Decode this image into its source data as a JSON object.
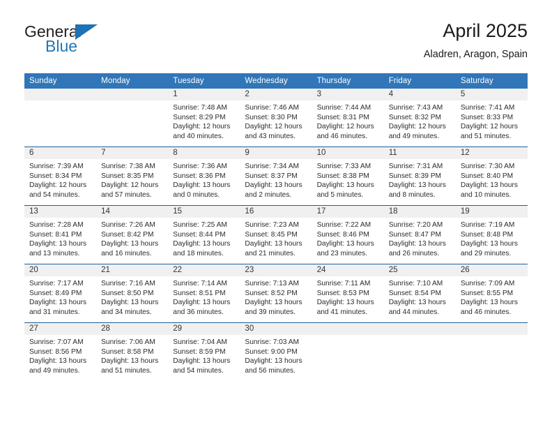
{
  "logo": {
    "primary_text": "General",
    "secondary_text": "Blue",
    "accent_color": "#1e72b5",
    "triangle_icon": "triangle-icon"
  },
  "header": {
    "title": "April 2025",
    "location": "Aladren, Aragon, Spain"
  },
  "theme": {
    "header_bg": "#3076b8",
    "row_divider": "#1b5f9e",
    "daynum_bg": "#f0f0f0"
  },
  "calendar": {
    "weekday_headers": [
      "Sunday",
      "Monday",
      "Tuesday",
      "Wednesday",
      "Thursday",
      "Friday",
      "Saturday"
    ],
    "labels": {
      "sunrise": "Sunrise:",
      "sunset": "Sunset:",
      "daylight": "Daylight:"
    },
    "weeks": [
      [
        {
          "day": "",
          "empty": true
        },
        {
          "day": "",
          "empty": true
        },
        {
          "day": "1",
          "sunrise": "Sunrise: 7:48 AM",
          "sunset": "Sunset: 8:29 PM",
          "daylight": "Daylight: 12 hours and 40 minutes."
        },
        {
          "day": "2",
          "sunrise": "Sunrise: 7:46 AM",
          "sunset": "Sunset: 8:30 PM",
          "daylight": "Daylight: 12 hours and 43 minutes."
        },
        {
          "day": "3",
          "sunrise": "Sunrise: 7:44 AM",
          "sunset": "Sunset: 8:31 PM",
          "daylight": "Daylight: 12 hours and 46 minutes."
        },
        {
          "day": "4",
          "sunrise": "Sunrise: 7:43 AM",
          "sunset": "Sunset: 8:32 PM",
          "daylight": "Daylight: 12 hours and 49 minutes."
        },
        {
          "day": "5",
          "sunrise": "Sunrise: 7:41 AM",
          "sunset": "Sunset: 8:33 PM",
          "daylight": "Daylight: 12 hours and 51 minutes."
        }
      ],
      [
        {
          "day": "6",
          "sunrise": "Sunrise: 7:39 AM",
          "sunset": "Sunset: 8:34 PM",
          "daylight": "Daylight: 12 hours and 54 minutes."
        },
        {
          "day": "7",
          "sunrise": "Sunrise: 7:38 AM",
          "sunset": "Sunset: 8:35 PM",
          "daylight": "Daylight: 12 hours and 57 minutes."
        },
        {
          "day": "8",
          "sunrise": "Sunrise: 7:36 AM",
          "sunset": "Sunset: 8:36 PM",
          "daylight": "Daylight: 13 hours and 0 minutes."
        },
        {
          "day": "9",
          "sunrise": "Sunrise: 7:34 AM",
          "sunset": "Sunset: 8:37 PM",
          "daylight": "Daylight: 13 hours and 2 minutes."
        },
        {
          "day": "10",
          "sunrise": "Sunrise: 7:33 AM",
          "sunset": "Sunset: 8:38 PM",
          "daylight": "Daylight: 13 hours and 5 minutes."
        },
        {
          "day": "11",
          "sunrise": "Sunrise: 7:31 AM",
          "sunset": "Sunset: 8:39 PM",
          "daylight": "Daylight: 13 hours and 8 minutes."
        },
        {
          "day": "12",
          "sunrise": "Sunrise: 7:30 AM",
          "sunset": "Sunset: 8:40 PM",
          "daylight": "Daylight: 13 hours and 10 minutes."
        }
      ],
      [
        {
          "day": "13",
          "sunrise": "Sunrise: 7:28 AM",
          "sunset": "Sunset: 8:41 PM",
          "daylight": "Daylight: 13 hours and 13 minutes."
        },
        {
          "day": "14",
          "sunrise": "Sunrise: 7:26 AM",
          "sunset": "Sunset: 8:42 PM",
          "daylight": "Daylight: 13 hours and 16 minutes."
        },
        {
          "day": "15",
          "sunrise": "Sunrise: 7:25 AM",
          "sunset": "Sunset: 8:44 PM",
          "daylight": "Daylight: 13 hours and 18 minutes."
        },
        {
          "day": "16",
          "sunrise": "Sunrise: 7:23 AM",
          "sunset": "Sunset: 8:45 PM",
          "daylight": "Daylight: 13 hours and 21 minutes."
        },
        {
          "day": "17",
          "sunrise": "Sunrise: 7:22 AM",
          "sunset": "Sunset: 8:46 PM",
          "daylight": "Daylight: 13 hours and 23 minutes."
        },
        {
          "day": "18",
          "sunrise": "Sunrise: 7:20 AM",
          "sunset": "Sunset: 8:47 PM",
          "daylight": "Daylight: 13 hours and 26 minutes."
        },
        {
          "day": "19",
          "sunrise": "Sunrise: 7:19 AM",
          "sunset": "Sunset: 8:48 PM",
          "daylight": "Daylight: 13 hours and 29 minutes."
        }
      ],
      [
        {
          "day": "20",
          "sunrise": "Sunrise: 7:17 AM",
          "sunset": "Sunset: 8:49 PM",
          "daylight": "Daylight: 13 hours and 31 minutes."
        },
        {
          "day": "21",
          "sunrise": "Sunrise: 7:16 AM",
          "sunset": "Sunset: 8:50 PM",
          "daylight": "Daylight: 13 hours and 34 minutes."
        },
        {
          "day": "22",
          "sunrise": "Sunrise: 7:14 AM",
          "sunset": "Sunset: 8:51 PM",
          "daylight": "Daylight: 13 hours and 36 minutes."
        },
        {
          "day": "23",
          "sunrise": "Sunrise: 7:13 AM",
          "sunset": "Sunset: 8:52 PM",
          "daylight": "Daylight: 13 hours and 39 minutes."
        },
        {
          "day": "24",
          "sunrise": "Sunrise: 7:11 AM",
          "sunset": "Sunset: 8:53 PM",
          "daylight": "Daylight: 13 hours and 41 minutes."
        },
        {
          "day": "25",
          "sunrise": "Sunrise: 7:10 AM",
          "sunset": "Sunset: 8:54 PM",
          "daylight": "Daylight: 13 hours and 44 minutes."
        },
        {
          "day": "26",
          "sunrise": "Sunrise: 7:09 AM",
          "sunset": "Sunset: 8:55 PM",
          "daylight": "Daylight: 13 hours and 46 minutes."
        }
      ],
      [
        {
          "day": "27",
          "sunrise": "Sunrise: 7:07 AM",
          "sunset": "Sunset: 8:56 PM",
          "daylight": "Daylight: 13 hours and 49 minutes."
        },
        {
          "day": "28",
          "sunrise": "Sunrise: 7:06 AM",
          "sunset": "Sunset: 8:58 PM",
          "daylight": "Daylight: 13 hours and 51 minutes."
        },
        {
          "day": "29",
          "sunrise": "Sunrise: 7:04 AM",
          "sunset": "Sunset: 8:59 PM",
          "daylight": "Daylight: 13 hours and 54 minutes."
        },
        {
          "day": "30",
          "sunrise": "Sunrise: 7:03 AM",
          "sunset": "Sunset: 9:00 PM",
          "daylight": "Daylight: 13 hours and 56 minutes."
        },
        {
          "day": "",
          "empty": true
        },
        {
          "day": "",
          "empty": true
        },
        {
          "day": "",
          "empty": true
        }
      ]
    ]
  }
}
